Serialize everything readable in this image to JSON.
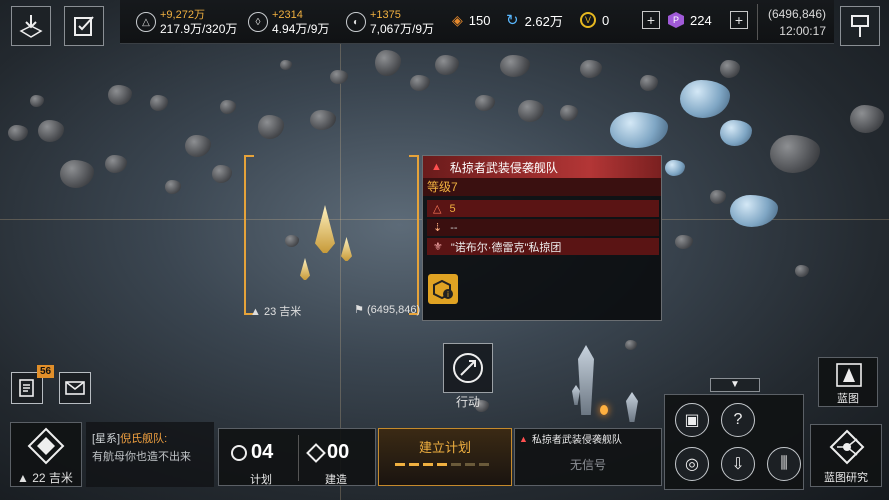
{
  "header": {
    "resource1": {
      "increment": "+9,272万",
      "amount": "217.9万/320万"
    },
    "resource2": {
      "increment": "+2314",
      "amount": "4.94万/9万"
    },
    "resource3": {
      "increment": "+1375",
      "amount": "7,067万/9万"
    },
    "fuel": "150",
    "cycle": "2.62万",
    "gold": "0",
    "premium": "224",
    "coords": "(6496,846)",
    "time": "12:00:17",
    "plus": "+"
  },
  "target": {
    "name": "私掠者武装侵袭舰队",
    "level": "等级7",
    "attack": "5",
    "defense": "--",
    "faction": "\"诺布尔·德雷克\"私掠团"
  },
  "map": {
    "distance": "23 吉米",
    "target_coords": "(6495,846)"
  },
  "actions": {
    "move_label": "行动"
  },
  "bottom": {
    "badge": "56",
    "self_distance": "22 吉米",
    "chat_channel": "[星系]",
    "chat_user": "倪氏舰队:",
    "chat_text": "有航母你也造不出来",
    "plan_count": "04",
    "plan_label": "计划",
    "build_count": "00",
    "build_label": "建造",
    "establish_plan": "建立计划",
    "mini_target": "私掠者武装侵袭舰队",
    "no_signal": "无信号",
    "blueprint": "蓝图",
    "blueprint_research": "蓝图研究"
  },
  "colors": {
    "accent": "#e6a33a",
    "enemy": "#b33636"
  }
}
